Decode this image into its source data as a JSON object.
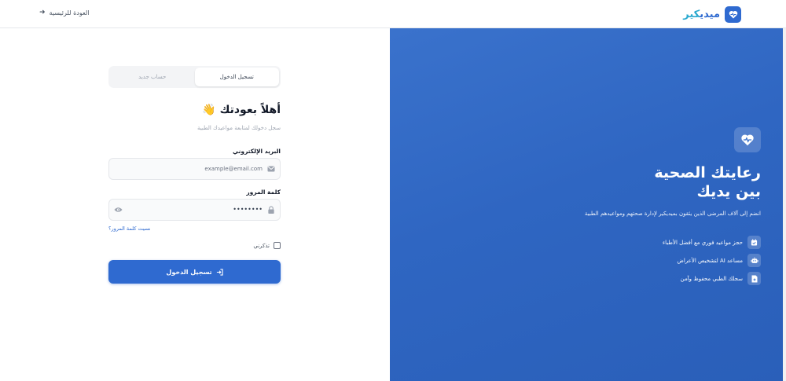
{
  "header": {
    "brand_part1": "ميدي",
    "brand_part2": "كير",
    "back_label": "العودة للرئيسية"
  },
  "auth": {
    "tabs": [
      {
        "label": "تسجيل الدخول",
        "active": true
      },
      {
        "label": "حساب جديد",
        "active": false
      }
    ],
    "welcome_title": "أهلاً بعودتك 👋",
    "subtitle": "سجل دخولك لمتابعة مواعيدك الطبية",
    "email": {
      "label": "البريد الإلكتروني",
      "placeholder": "example@email.com",
      "icon": "mail-icon"
    },
    "password": {
      "label": "كلمة المرور",
      "value": "••••••••",
      "icon": "lock-icon",
      "toggle_icon": "eye-icon"
    },
    "forgot_label": "نسيت كلمة المرور؟",
    "remember_label": "تذكرني",
    "remember_checked": false,
    "submit_label": "تسجيل الدخول"
  },
  "hero": {
    "icon": "heart-pulse-icon",
    "title_line1": "رعايتك الصحية",
    "title_line2": "بين يديك",
    "description": "انضم إلى آلاف المرضى الذين يثقون بميديكير لإدارة صحتهم ومواعيدهم الطبية",
    "features": [
      {
        "text": "حجز مواعيد فوري مع أفضل الأطباء",
        "icon": "calendar-check-icon"
      },
      {
        "text": "مساعد AI لتشخيص الأعراض",
        "icon": "robot-icon"
      },
      {
        "text": "سجلك الطبي محفوظ وآمن",
        "icon": "file-medical-icon"
      }
    ]
  },
  "colors": {
    "primary": "#2f6ad0",
    "accent": "#2aa9cf",
    "hero_bg": "#2f66c2"
  }
}
